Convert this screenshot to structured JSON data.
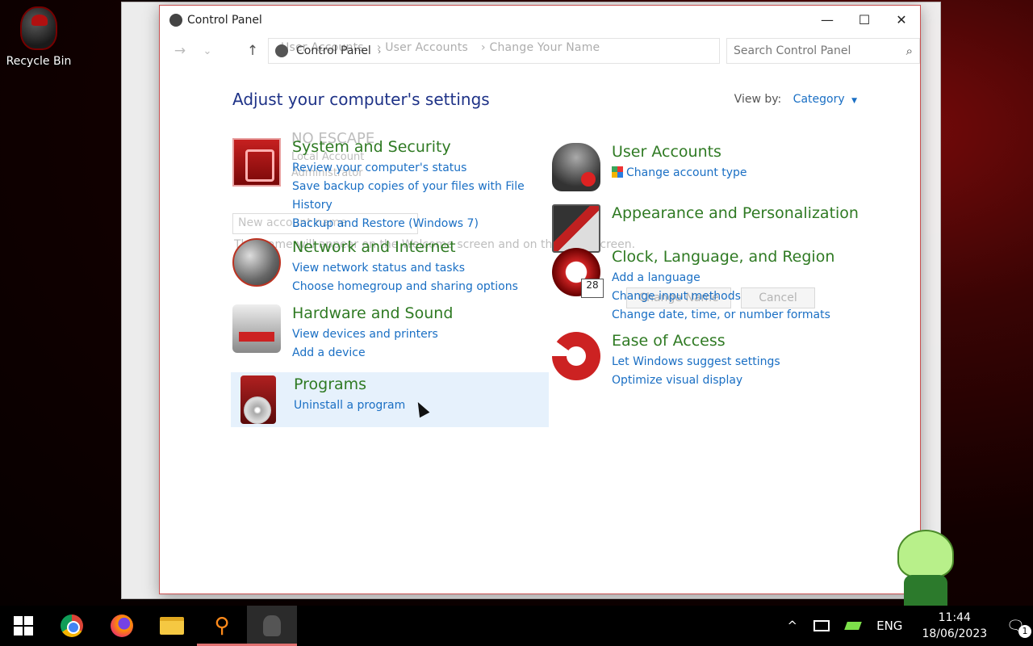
{
  "desktop": {
    "recycle_bin_label": "Recycle Bin"
  },
  "window": {
    "title": "Control Panel",
    "controls": {
      "minimize": "—",
      "maximize": "☐",
      "close": "✕"
    }
  },
  "navbar": {
    "back": "←",
    "forward": "→",
    "recent": "⌄",
    "up": "↑",
    "address_label": "Control Panel",
    "ghost_crumbs": [
      "User Accounts",
      "User Accounts",
      "Change Your Name"
    ],
    "search_placeholder": "Search Control Panel"
  },
  "main": {
    "heading": "Adjust your computer's settings",
    "view_by_label": "View by:",
    "view_by_value": "Category",
    "categories_left": [
      {
        "title": "System and Security",
        "icon": "shield-icon",
        "links": [
          "Review your computer's status",
          "Save backup copies of your files with File History",
          "Backup and Restore (Windows 7)"
        ]
      },
      {
        "title": "Network and Internet",
        "icon": "globe-icon",
        "links": [
          "View network status and tasks",
          "Choose homegroup and sharing options"
        ]
      },
      {
        "title": "Hardware and Sound",
        "icon": "printer-icon",
        "links": [
          "View devices and printers",
          "Add a device"
        ]
      },
      {
        "title": "Programs",
        "icon": "programs-icon",
        "links": [
          "Uninstall a program"
        ]
      }
    ],
    "categories_right": [
      {
        "title": "User Accounts",
        "icon": "users-icon",
        "links": [
          "Change account type"
        ]
      },
      {
        "title": "Appearance and Personalization",
        "icon": "monitor-icon",
        "links": []
      },
      {
        "title": "Clock, Language, and Region",
        "icon": "clock-icon",
        "links": [
          "Add a language",
          "Change input methods",
          "Change date, time, or number formats"
        ]
      },
      {
        "title": "Ease of Access",
        "icon": "ease-of-access-icon",
        "links": [
          "Let Windows suggest settings",
          "Optimize visual display"
        ]
      }
    ]
  },
  "ghost_dialog": {
    "account_name": "NO ESCAPE",
    "account_type": "Local Account",
    "account_role": "Administrator",
    "field_placeholder": "New account name",
    "note": "This name will appear on the Welcome screen and on the Start screen.",
    "change_name_button": "Change Name",
    "cancel_button": "Cancel"
  },
  "taskbar": {
    "apps": [
      "start-icon",
      "chrome-icon",
      "firefox-icon",
      "file-explorer-icon",
      "search-magnifier-icon",
      "media-app-icon"
    ],
    "language": "ENG",
    "time": "11:44",
    "date": "18/06/2023",
    "notification_count": "1",
    "tray_chevron": "^"
  },
  "colors": {
    "heading": "#1e3287",
    "category_title": "#2f7a23",
    "link": "#1a6fc4",
    "hover_bg": "#e6f1fc"
  }
}
